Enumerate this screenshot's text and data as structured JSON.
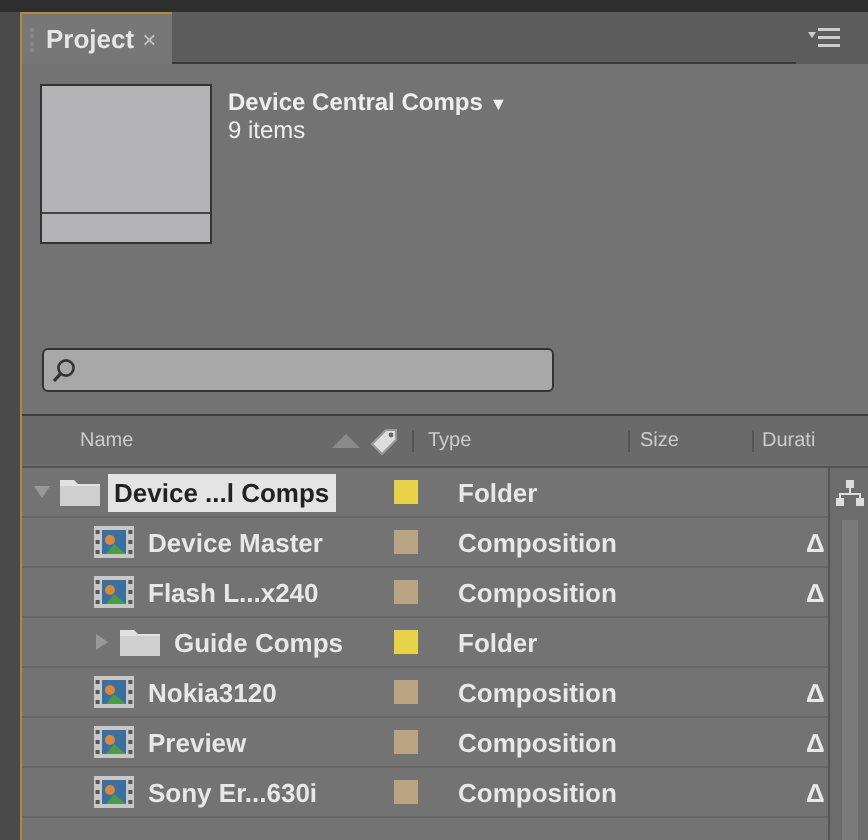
{
  "panel": {
    "tab": {
      "label": "Project",
      "close": "×",
      "selected": true
    }
  },
  "header": {
    "title": "Device Central Comps",
    "count": "9 items",
    "dropdown": "▼"
  },
  "columns": [
    {
      "label": "Name"
    },
    {
      "label": "Type"
    },
    {
      "label": "Size"
    },
    {
      "label": "Durati"
    }
  ],
  "items": [
    {
      "kind": "folder",
      "name": "Device ...l Comps",
      "type": "Folder",
      "color": "#e8d24a",
      "selected": true,
      "expanded": true,
      "children": [
        {
          "kind": "comp",
          "name": "Device Master",
          "type": "Composition",
          "color": "#b9a484",
          "selected": false,
          "duration": "Δ"
        },
        {
          "kind": "comp",
          "name": "Flash L...x240",
          "type": "Composition",
          "color": "#b9a484",
          "selected": false,
          "duration": "Δ"
        },
        {
          "kind": "folder",
          "name": "Guide Comps",
          "type": "Folder",
          "color": "#e8d24a",
          "selected": false,
          "expanded": false
        },
        {
          "kind": "comp",
          "name": "Nokia3120",
          "type": "Composition",
          "color": "#b9a484",
          "selected": false,
          "duration": "Δ"
        },
        {
          "kind": "comp",
          "name": "Preview",
          "type": "Composition",
          "color": "#b9a484",
          "selected": false,
          "duration": "Δ"
        },
        {
          "kind": "comp",
          "name": "Sony Er...630i",
          "type": "Composition",
          "color": "#b9a484",
          "selected": false,
          "duration": "Δ"
        }
      ]
    }
  ]
}
